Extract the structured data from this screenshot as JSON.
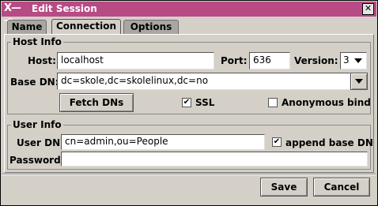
{
  "window": {
    "title": "Edit Session",
    "app_icon": "X—⇥",
    "close": "✕"
  },
  "tabs": [
    {
      "label": "Name"
    },
    {
      "label": "Connection"
    },
    {
      "label": "Options"
    }
  ],
  "host_info": {
    "group_label": "Host Info",
    "host_label": "Host:",
    "host_value": "localhost",
    "port_label": "Port:",
    "port_value": "636",
    "version_label": "Version:",
    "version_value": "3",
    "base_dn_label": "Base DN:",
    "base_dn_value": "dc=skole,dc=skolelinux,dc=no",
    "fetch_dns_label": "Fetch DNs",
    "ssl_label": "SSL",
    "ssl_checked": true,
    "anonymous_bind_label": "Anonymous bind",
    "anonymous_bind_checked": false
  },
  "user_info": {
    "group_label": "User Info",
    "user_dn_label": "User DN:",
    "user_dn_value": "cn=admin,ou=People",
    "append_base_dn_label": "append base DN",
    "append_base_dn_checked": true,
    "password_label": "Password:",
    "password_value": ""
  },
  "buttons": {
    "save": "Save",
    "cancel": "Cancel"
  },
  "colors": {
    "titlebar": "#b84a86",
    "window_bg": "#d4d0c8"
  }
}
